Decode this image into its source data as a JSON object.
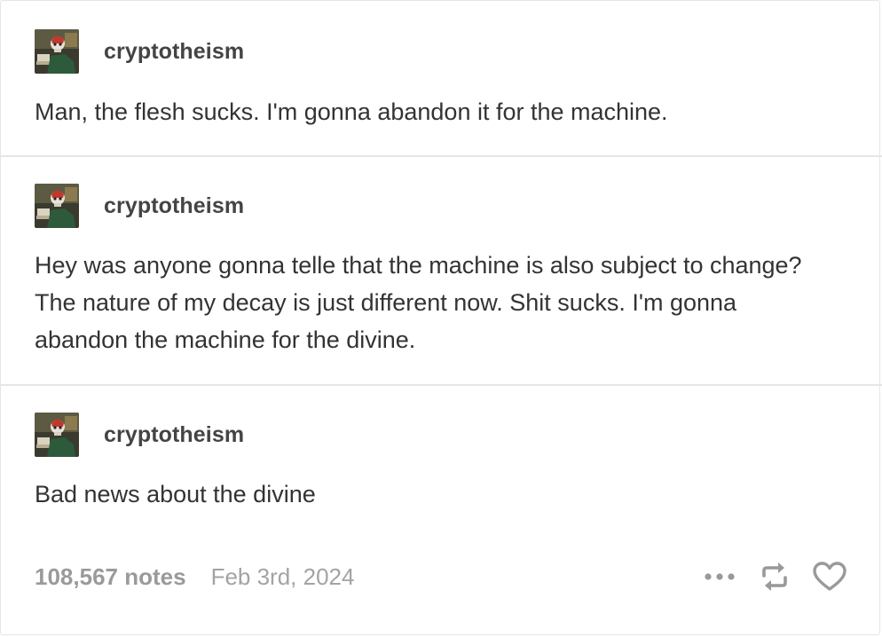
{
  "posts": [
    {
      "username": "cryptotheism",
      "text": "Man, the flesh sucks. I'm gonna abandon it for the machine."
    },
    {
      "username": "cryptotheism",
      "text": "Hey was anyone gonna telle that the machine is also subject to change? The nature of my decay is just different now. Shit sucks. I'm gonna abandon the machine for the divine."
    },
    {
      "username": "cryptotheism",
      "text": "Bad news about the divine"
    }
  ],
  "footer": {
    "notes": "108,567 notes",
    "date": "Feb 3rd, 2024"
  },
  "icons": {
    "more": "more-dots-icon",
    "reblog": "reblog-icon",
    "like": "heart-icon"
  },
  "colors": {
    "text": "#333333",
    "muted": "#9a9a9a",
    "divider": "#e6e6e6",
    "icon": "#999999"
  }
}
